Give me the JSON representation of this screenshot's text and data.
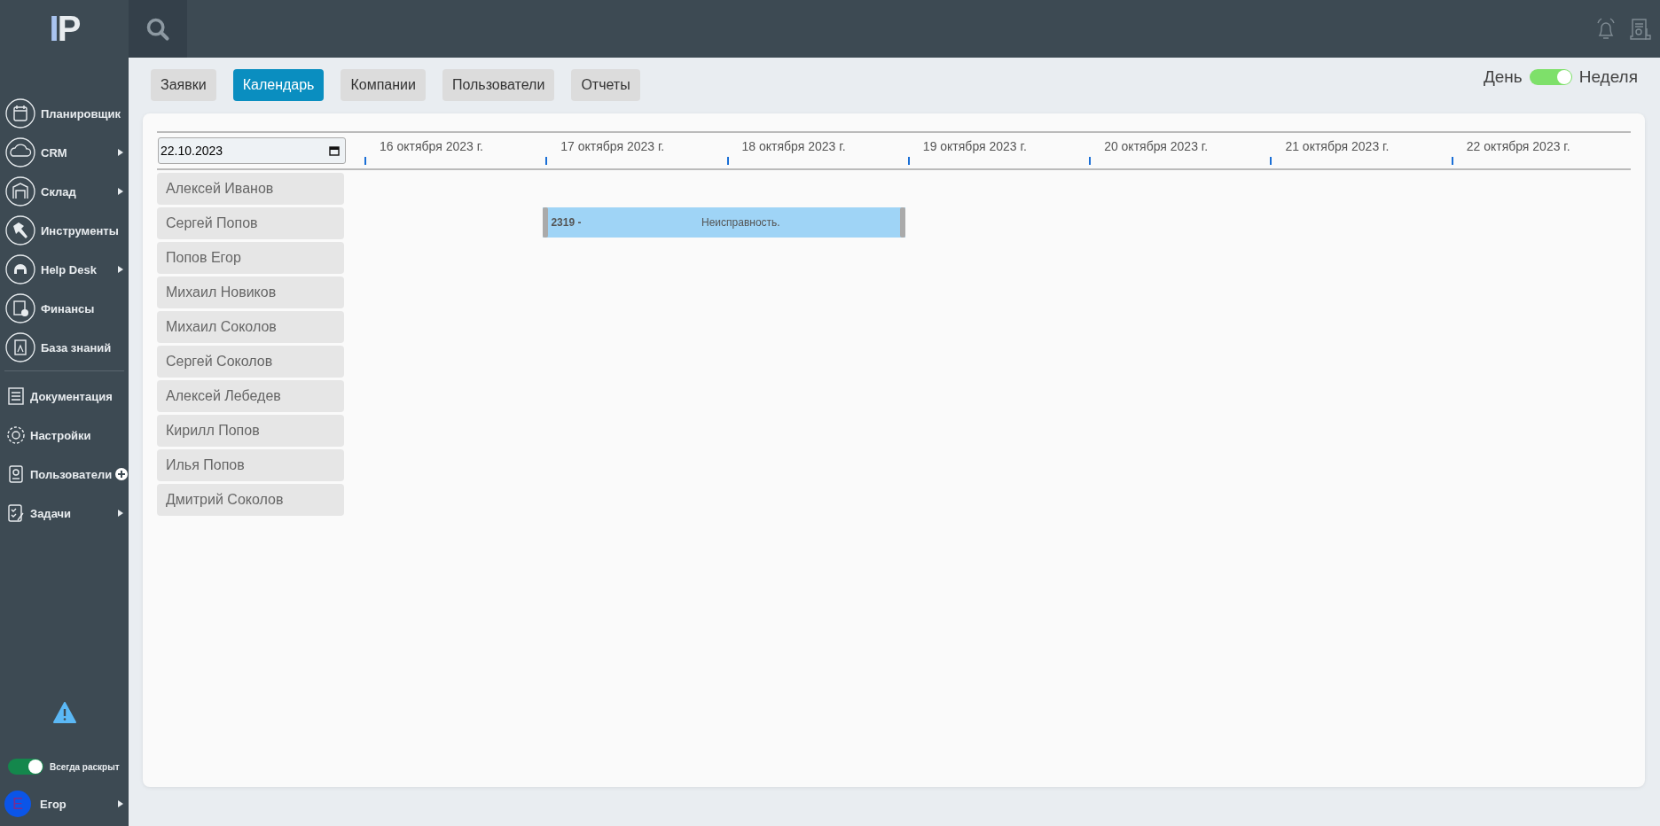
{
  "logo": {
    "text": "IP"
  },
  "sidebar": {
    "items": [
      {
        "label": "Планировщик",
        "has_submenu": false
      },
      {
        "label": "CRM",
        "has_submenu": true
      },
      {
        "label": "Склад",
        "has_submenu": true
      },
      {
        "label": "Инструменты",
        "has_submenu": false
      },
      {
        "label": "Help Desk",
        "has_submenu": true
      },
      {
        "label": "Финансы",
        "has_submenu": false
      },
      {
        "label": "База знаний",
        "has_submenu": false
      }
    ],
    "secondary_items": [
      {
        "label": "Документация",
        "has_submenu": false,
        "has_add": false
      },
      {
        "label": "Настройки",
        "has_submenu": false,
        "has_add": false
      },
      {
        "label": "Пользователи",
        "has_submenu": false,
        "has_add": true
      },
      {
        "label": "Задачи",
        "has_submenu": true,
        "has_add": false
      }
    ],
    "always_expanded": {
      "label": "Всегда раскрыт",
      "on": true
    },
    "user": {
      "initial": "Е",
      "name": "Егор"
    }
  },
  "tabs": [
    {
      "label": "Заявки",
      "selected": false
    },
    {
      "label": "Календарь",
      "selected": true
    },
    {
      "label": "Компании",
      "selected": false
    },
    {
      "label": "Пользователи",
      "selected": false
    },
    {
      "label": "Отчеты",
      "selected": false
    }
  ],
  "view_toggle": {
    "left": "День",
    "right": "Неделя",
    "on": true
  },
  "calendar": {
    "date": "22.10.2023",
    "days": [
      "16 октября 2023 г.",
      "17 октября 2023 г.",
      "18 октября 2023 г.",
      "19 октября 2023 г.",
      "20 октября 2023 г.",
      "21 октября 2023 г.",
      "22 октября 2023 г."
    ],
    "employees": [
      {
        "name": "Алексей Иванов"
      },
      {
        "name": "Сергей Попов",
        "events": [
          {
            "number": "2319 -",
            "title": "Неисправность.",
            "covers": [
              false,
              true,
              true,
              false,
              false,
              false,
              false
            ]
          }
        ]
      },
      {
        "name": "Попов Егор"
      },
      {
        "name": "Михаил Новиков"
      },
      {
        "name": "Михаил Соколов"
      },
      {
        "name": "Сергей Соколов"
      },
      {
        "name": "Алексей Лебедев"
      },
      {
        "name": "Кирилл Попов"
      },
      {
        "name": "Илья Попов"
      },
      {
        "name": "Дмитрий Соколов"
      }
    ]
  }
}
